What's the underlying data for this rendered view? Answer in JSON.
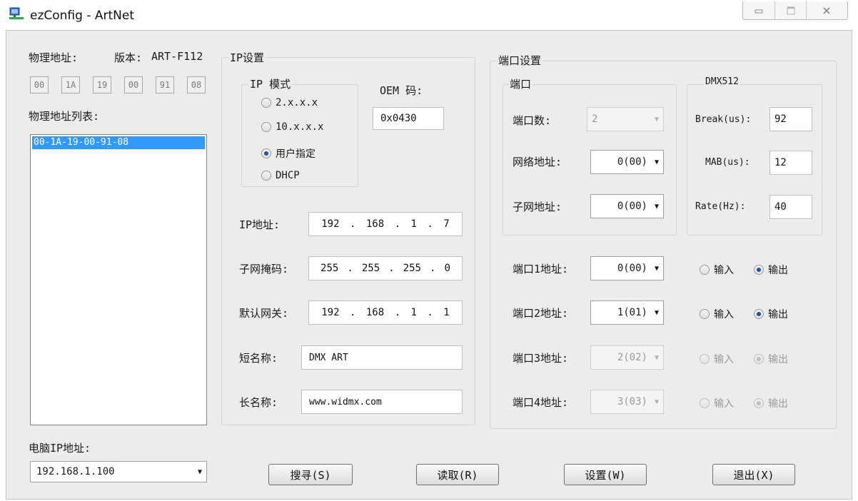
{
  "window": {
    "title": "ezConfig - ArtNet",
    "minimize_icon": "minimize-icon",
    "maximize_icon": "maximize-icon",
    "close_icon": "close-icon"
  },
  "mac": {
    "label": "物理地址:",
    "version_label": "版本:",
    "version": "ART-F112",
    "octets": [
      "00",
      "1A",
      "19",
      "00",
      "91",
      "08"
    ],
    "list_label": "物理地址列表:",
    "list_items": [
      "00-1A-19-00-91-08"
    ],
    "selected_index": 0
  },
  "pc_ip": {
    "label": "电脑IP地址:",
    "value": "192.168.1.100"
  },
  "ip_settings": {
    "title": "IP设置",
    "mode_title": "IP 模式",
    "modes": [
      "2.x.x.x",
      "10.x.x.x",
      "用户指定",
      "DHCP"
    ],
    "selected_mode": "用户指定",
    "oem_label": "OEM 码:",
    "oem_value": "0x0430",
    "ip_label": "IP地址:",
    "ip": [
      "192",
      "168",
      "1",
      "7"
    ],
    "mask_label": "子网掩码:",
    "mask": [
      "255",
      "255",
      "255",
      "0"
    ],
    "gateway_label": "默认网关:",
    "gateway": [
      "192",
      "168",
      "1",
      "1"
    ],
    "short_name_label": "短名称:",
    "short_name": "DMX ART",
    "long_name_label": "长名称:",
    "long_name": "www.widmx.com"
  },
  "port_settings": {
    "title": "端口设置",
    "port_group": "端口",
    "port_count_label": "端口数:",
    "port_count": "2",
    "net_label": "网络地址:",
    "net": "0(00)",
    "subnet_label": "子网地址:",
    "subnet": "0(00)",
    "dmx_group": "DMX512",
    "break_label": "Break(us):",
    "break_value": "92",
    "mab_label": "MAB(us):",
    "mab_value": "12",
    "rate_label": "Rate(Hz):",
    "rate_value": "40",
    "input_label": "输入",
    "output_label": "输出",
    "ports": [
      {
        "label": "端口1地址:",
        "value": "0(00)",
        "mode": "output",
        "enabled": true
      },
      {
        "label": "端口2地址:",
        "value": "1(01)",
        "mode": "output",
        "enabled": true
      },
      {
        "label": "端口3地址:",
        "value": "2(02)",
        "mode": "output",
        "enabled": false
      },
      {
        "label": "端口4地址:",
        "value": "3(03)",
        "mode": "output",
        "enabled": false
      }
    ]
  },
  "buttons": {
    "search": "搜寻(S)",
    "read": "读取(R)",
    "set": "设置(W)",
    "exit": "退出(X)"
  }
}
